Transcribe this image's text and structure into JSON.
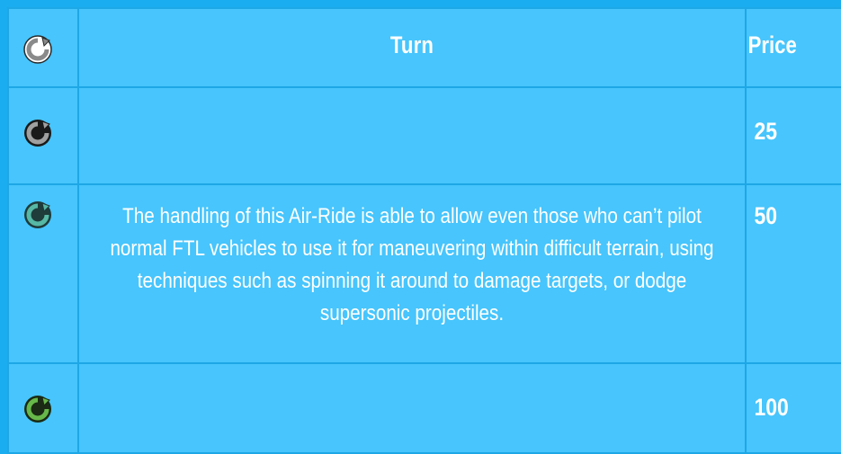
{
  "table": {
    "header": {
      "icon": "turn-icon-white",
      "title": "Turn",
      "price_label": "Price"
    },
    "rows": [
      {
        "icon": "turn-icon-gray",
        "icon_color": "#a0a0a0",
        "description": "",
        "price": "25"
      },
      {
        "icon": "turn-icon-teal",
        "icon_color": "#56b8a5",
        "description": "The handling of this Air-Ride is able to allow even those who can’t pilot normal FTL vehicles to use it for maneuvering within difficult terrain, using techniques such as spinning it around to damage targets, or dodge supersonic projectiles.",
        "price": "50"
      },
      {
        "icon": "turn-icon-green",
        "icon_color": "#67b84a",
        "description": "",
        "price": "100"
      }
    ]
  },
  "colors": {
    "page_background": "#0fb0f5",
    "cell_background": "#47c5fc",
    "border": "#1ea7e6",
    "text": "#ffffff"
  }
}
